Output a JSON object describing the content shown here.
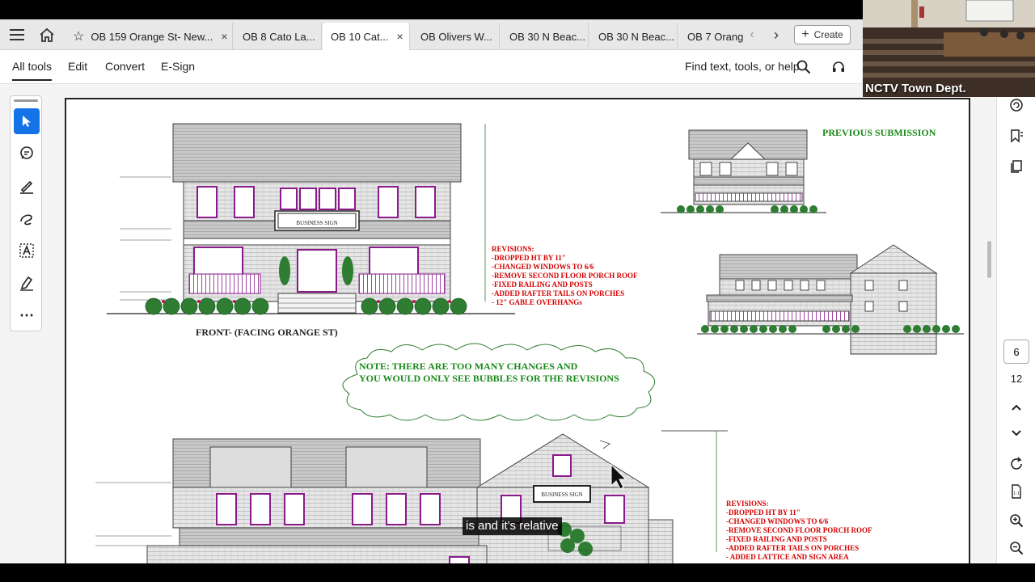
{
  "tabs": [
    {
      "label": "OB 159 Orange St- New...",
      "active": false,
      "starred": true,
      "closable": true
    },
    {
      "label": "OB 8 Cato La...",
      "active": false
    },
    {
      "label": "OB 10 Cat...",
      "active": true,
      "closable": true
    },
    {
      "label": "OB Olivers W...",
      "active": false
    },
    {
      "label": "OB 30 N Beac...",
      "active": false
    },
    {
      "label": "OB 30 N Beac...",
      "active": false
    },
    {
      "label": "OB 7 Orang",
      "active": false
    }
  ],
  "toolbar": {
    "create_label": "Create",
    "close_glyph": "×",
    "plus_glyph": "+"
  },
  "menu": {
    "items": [
      "All tools",
      "Edit",
      "Convert",
      "E-Sign"
    ],
    "find_label": "Find text, tools, or help"
  },
  "page_nav": {
    "current": "6",
    "total": "12"
  },
  "video": {
    "label": "NCTV Town Dept."
  },
  "caption": {
    "text": "is and it's relative"
  },
  "drawing": {
    "front_title": "FRONT- (FACING ORANGE ST)",
    "previous_submission": "PREVIOUS SUBMISSION",
    "business_sign": "BUSINESS SIGN",
    "note_line1": "NOTE: THERE ARE TOO MANY CHANGES AND",
    "note_line2": "YOU WOULD ONLY SEE BUBBLES FOR THE REVISIONS",
    "revisions_top": [
      "REVISIONS:",
      "-DROPPED HT BY 11\"",
      "-CHANGED WINDOWS TO 6/6",
      "-REMOVE SECOND FLOOR PORCH ROOF",
      "-FIXED RAILING AND POSTS",
      "-ADDED RAFTER TAILS ON PORCHES",
      "- 12\" GABLE OVERHANGs"
    ],
    "revisions_bottom": [
      "REVISIONS:",
      "-DROPPED HT BY 11\"",
      "-CHANGED WINDOWS TO 6/6",
      "-REMOVE SECOND FLOOR PORCH ROOF",
      "-FIXED RAILING AND POSTS",
      "-ADDED RAFTER TAILS ON PORCHES",
      "- ADDED LATTICE AND SIGN AREA"
    ],
    "colors": {
      "revision_red": "#d40000",
      "note_green": "#1a8a1a",
      "trim_purple": "#8a1a8a",
      "shrub_green": "#2e7d32"
    }
  }
}
